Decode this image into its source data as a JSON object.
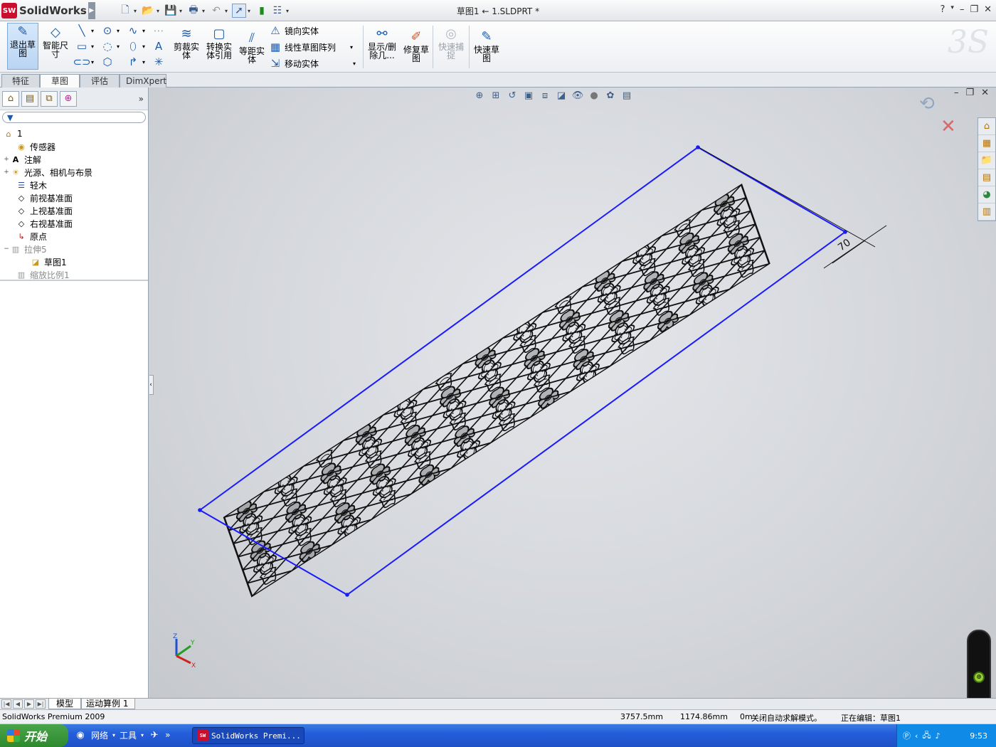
{
  "app": {
    "name": "SolidWorks",
    "title": "草图1 ← 1.SLDPRT *",
    "help": "?",
    "help_caret": "▾",
    "minimize": "–",
    "restore": "❐",
    "close": "✕"
  },
  "ribbon": {
    "exit_sketch": "退出草图",
    "smart_dim": "智能尺寸",
    "trim": "剪裁实体",
    "convert": "转换实体引用",
    "offset": "等距实体",
    "mirror": "镜向实体",
    "linear_pattern": "线性草图阵列",
    "move": "移动实体",
    "show_delete": "显示/删除几...",
    "repair": "修复草图",
    "quick_snap": "快速捕捉",
    "rapid_sketch": "快速草图"
  },
  "tabs": [
    "特征",
    "草图",
    "评估",
    "DimXpert"
  ],
  "feature_tree": {
    "root": "1",
    "items": [
      {
        "label": "传感器",
        "expand": "",
        "icon": "sensor-icon",
        "dim": false
      },
      {
        "label": "注解",
        "expand": "+",
        "icon": "annotation-icon",
        "dim": false
      },
      {
        "label": "光源、相机与布景",
        "expand": "+",
        "icon": "lights-icon",
        "dim": false
      },
      {
        "label": "轻木",
        "expand": "",
        "icon": "material-icon",
        "dim": false
      },
      {
        "label": "前视基准面",
        "expand": "",
        "icon": "plane-icon",
        "dim": false
      },
      {
        "label": "上视基准面",
        "expand": "",
        "icon": "plane-icon",
        "dim": false
      },
      {
        "label": "右视基准面",
        "expand": "",
        "icon": "plane-icon",
        "dim": false
      },
      {
        "label": "原点",
        "expand": "",
        "icon": "origin-icon",
        "dim": false
      },
      {
        "label": "拉伸5",
        "expand": "−",
        "icon": "extrude-icon",
        "dim": true
      },
      {
        "label": "草图1",
        "expand": "",
        "icon": "sketch-icon",
        "dim": false
      },
      {
        "label": "缩放比例1",
        "expand": "",
        "icon": "scale-icon",
        "dim": true
      }
    ]
  },
  "viewport": {
    "dimension": "70",
    "axes": {
      "x": "X",
      "y": "Y",
      "z": "Z"
    }
  },
  "bottom_tabs": [
    "模型",
    "运动算例 1"
  ],
  "status": {
    "product": "SolidWorks Premium 2009",
    "x": "3757.5mm",
    "y": "1174.86mm",
    "z": "0m",
    "solve_mode": "关闭自动求解模式。",
    "editing": "正在编辑：草图1"
  },
  "taskbar": {
    "start": "开始",
    "network": "网络",
    "tools": "工具",
    "window": "SolidWorks Premi...",
    "time": "9:53"
  },
  "colors": {
    "sketch_line": "#1a1aff",
    "geometry": "#111111",
    "background": "#d5d8dc"
  }
}
